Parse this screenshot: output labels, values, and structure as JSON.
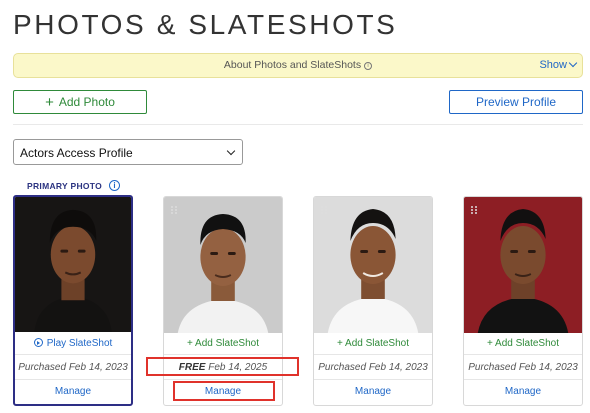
{
  "page": {
    "title": "PHOTOS & SLATESHOTS"
  },
  "about": {
    "text": "About Photos and SlateShots",
    "info_glyph": "i",
    "toggle_label": "Show"
  },
  "toolbar": {
    "add_photo_label": "Add Photo",
    "preview_label": "Preview Profile"
  },
  "profile_select": {
    "selected": "Actors Access Profile"
  },
  "primary": {
    "label": "PRIMARY PHOTO",
    "info_glyph": "i"
  },
  "colors": {
    "accent_blue": "#1f67c7",
    "add_green": "#2f8a3a",
    "primary_border": "#2d2e85",
    "highlight_red": "#e0322b",
    "banner_yellow": "#fbf8c9"
  },
  "cards": [
    {
      "action_label": "Play SlateShot",
      "action_icon": "play-circle-icon",
      "status_prefix": "",
      "status_text": "Purchased Feb 14, 2023",
      "manage_label": "Manage",
      "background": "#1a1817"
    },
    {
      "action_label": "+ Add SlateShot",
      "status_prefix": "FREE",
      "status_text": " Feb 14, 2025",
      "manage_label": "Manage",
      "background": "#c9c9c9"
    },
    {
      "action_label": "+ Add SlateShot",
      "status_prefix": "",
      "status_text": "Purchased Feb 14, 2023",
      "manage_label": "Manage",
      "background": "#d9d9d9"
    },
    {
      "action_label": "+ Add SlateShot",
      "status_prefix": "",
      "status_text": "Purchased Feb 14, 2023",
      "manage_label": "Manage",
      "background": "#8f1f24"
    }
  ]
}
